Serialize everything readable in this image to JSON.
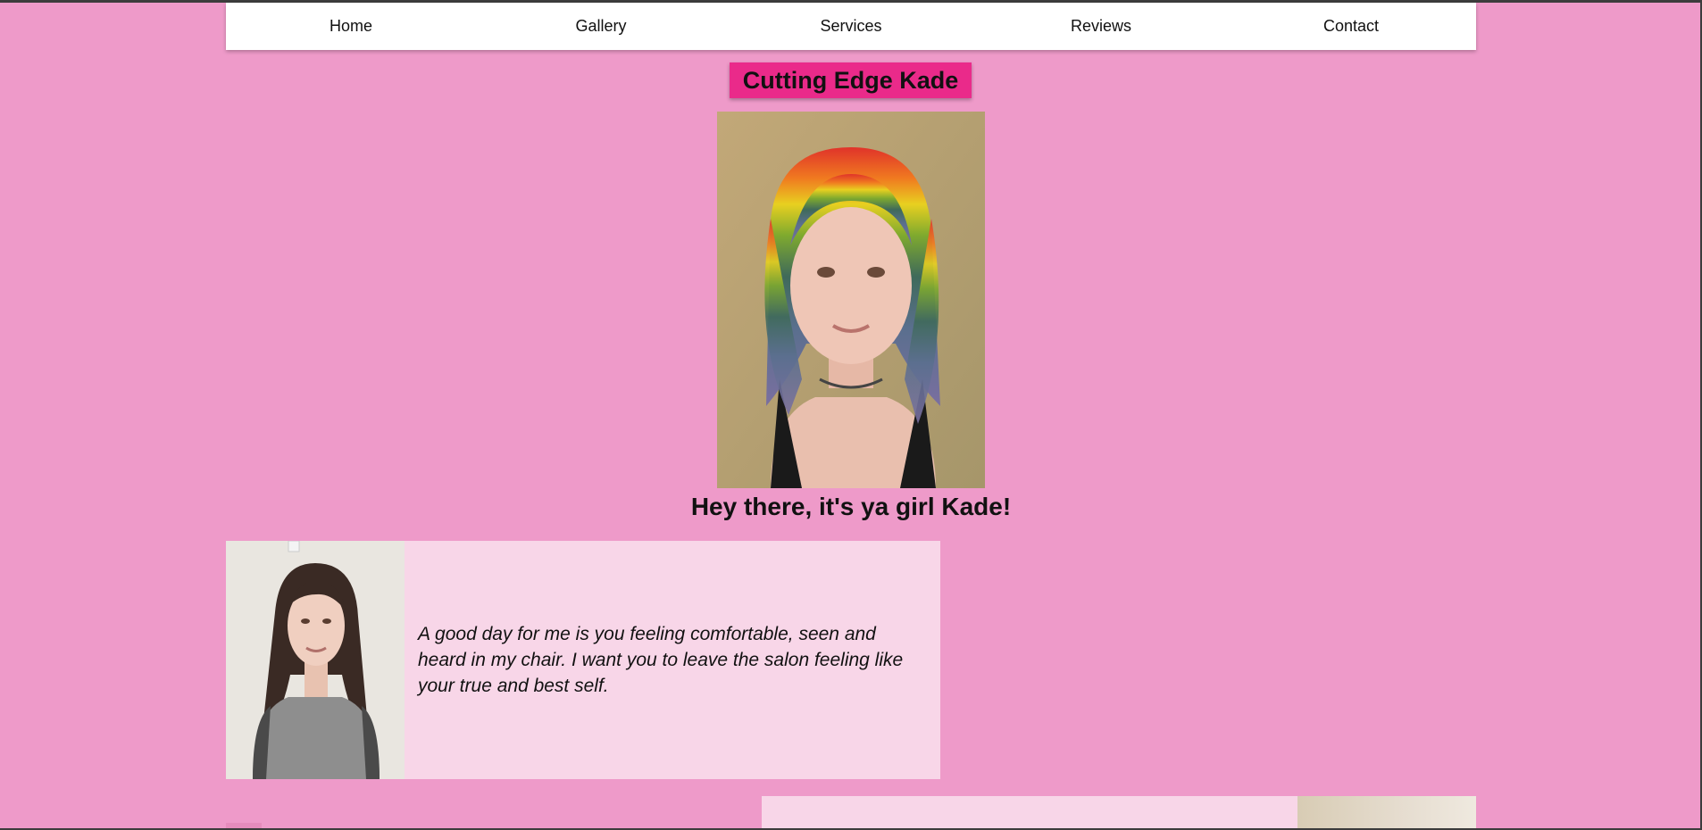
{
  "nav": {
    "items": [
      {
        "label": "Home"
      },
      {
        "label": "Gallery"
      },
      {
        "label": "Services"
      },
      {
        "label": "Reviews"
      },
      {
        "label": "Contact"
      }
    ]
  },
  "header": {
    "title": "Cutting Edge Kade"
  },
  "hero": {
    "photo_icon": "stylist-portrait-photo",
    "greeting": "Hey there, it's ya girl Kade!"
  },
  "about": {
    "photo_icon": "client-portrait-photo",
    "quote": "A good day for me is you feeling comfortable, seen and heard in my chair. I want you to leave the salon feeling like your true and best self."
  },
  "colors": {
    "page_bg": "#ee9ac9",
    "nav_bg": "#ffffff",
    "badge_bg": "#ea2a8a",
    "card_bg": "#f8d6e8"
  }
}
